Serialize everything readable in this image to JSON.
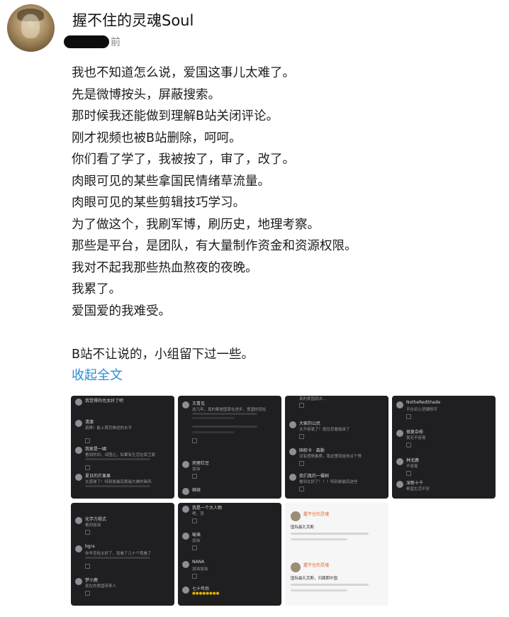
{
  "user": {
    "name": "握不住的灵魂Soul",
    "time_suffix": "前"
  },
  "post": {
    "lines": [
      "我也不知道怎么说，爱国这事儿太难了。",
      "先是微博按头，屏蔽搜索。",
      "那时候我还能做到理解B站关闭评论。",
      "刚才视频也被B站删除，呵呵。",
      "你们看了学了，我被按了，审了，改了。",
      "肉眼可见的某些拿国民情绪草流量。",
      "肉眼可见的某些剪辑技巧学习。",
      "为了做这个，我刷军博，刷历史，地理考察。",
      "那些是平台，是团队，有大量制作资金和资源权限。",
      "我对不起我那些热血熬夜的夜晚。",
      "我累了。",
      "爱国爱的我难受。"
    ],
    "closing": "B站不让说的，小组留下过一些。",
    "collapse_label": "收起全文"
  },
  "images": {
    "t1": [
      {
        "name": "我觉得的也太好了吧",
        "text": ""
      },
      {
        "name": "清澈",
        "text": "真棒！能上首页推进的水平"
      },
      {
        "name": "我家是一國",
        "text": "看到的到，试图让，如果有生活在保卫家"
      },
      {
        "name": "夏日的芒果果",
        "text": "太感谢了！特别是最后那遍大佛的画风"
      }
    ],
    "t2": [
      {
        "name": "王青见",
        "text": "这几年，真的都是国家在进步，爱国的现在"
      },
      {
        "name": "房屋红豆",
        "text": "加油"
      },
      {
        "name": "继续",
        "text": ""
      }
    ],
    "t3": [
      {
        "name": "真的爱国就去...",
        "text": ""
      },
      {
        "name": "大家的公民",
        "text": "太不容易了！挺住您看能审了"
      },
      {
        "name": "国权卡 · 森勒",
        "text": "没有感情素质，我这里就给你点个赞"
      },
      {
        "name": "我们真的一棵树",
        "text": "看到太好了！！！特别是最后这些"
      }
    ],
    "t4": [
      {
        "name": "NotheRedShade",
        "text": "不在初心坚硬即可"
      },
      {
        "name": "很复杂枝",
        "text": "我无不容易"
      },
      {
        "name": "林北鹿",
        "text": "不容易"
      },
      {
        "name": "深新十千",
        "text": "希望生活平安"
      }
    ],
    "t5": [
      {
        "name": "化学方程式",
        "text": "看到加油"
      },
      {
        "name": "bgra",
        "text": "你辛苦啦太好了，就看了几十个我看了"
      },
      {
        "name": "梦小鹿",
        "text": "现在的爱国带来人"
      }
    ],
    "t6": [
      {
        "name": "我是一个大人物",
        "text": "嗯，顶"
      },
      {
        "name": "喻夷",
        "text": "加油"
      },
      {
        "name": "NANA",
        "text": "加油加油"
      },
      {
        "name": "七十年后",
        "text": ""
      }
    ],
    "t7": [
      {
        "name": "握不住的灵魂",
        "text": "国际最孔克斯"
      },
      {
        "name": "握不住的灵魂",
        "text": "国际最孔克斯，归属期中国"
      }
    ]
  }
}
